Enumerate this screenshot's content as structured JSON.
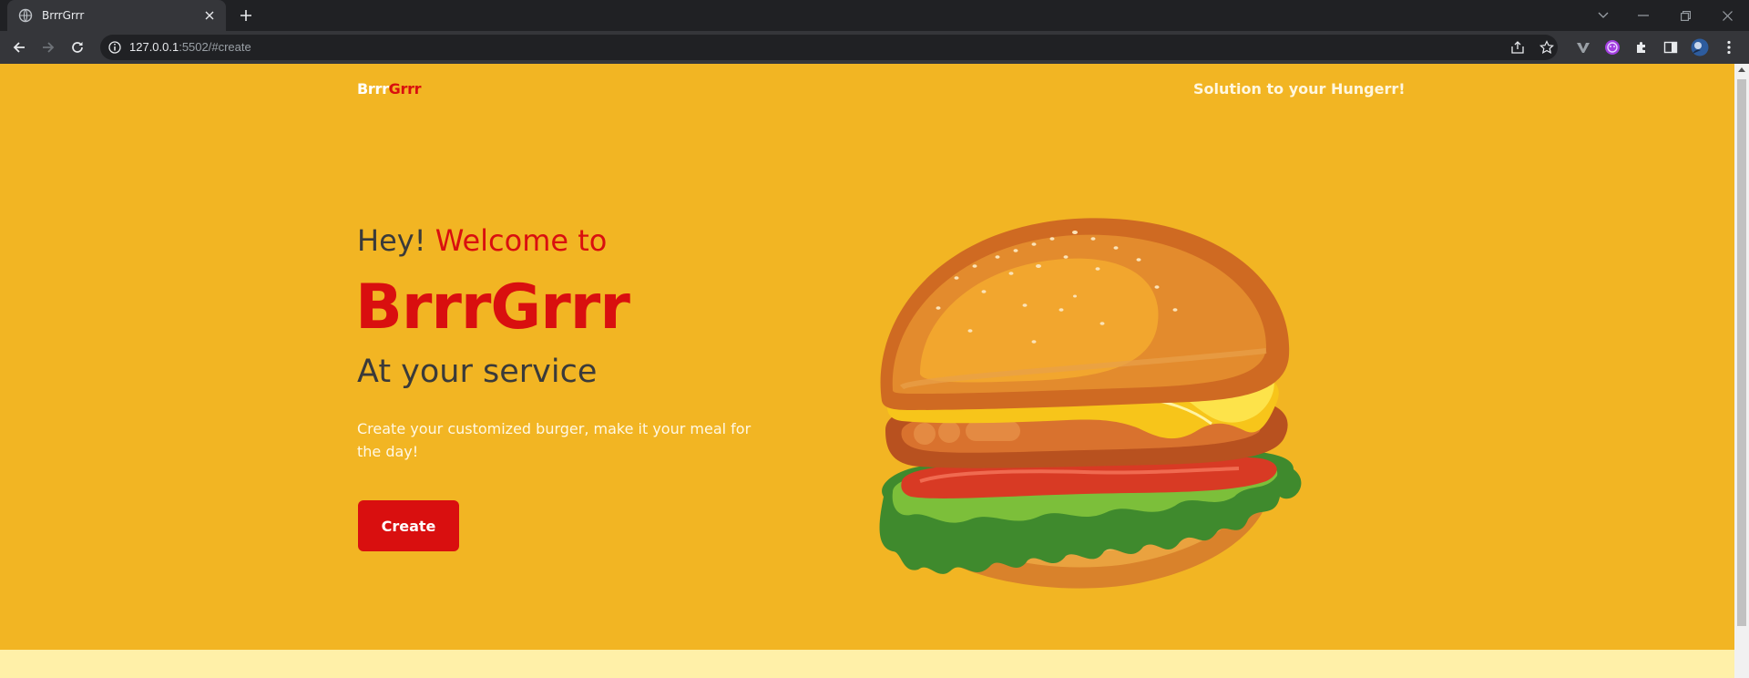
{
  "browser": {
    "tab_title": "BrrrGrrr",
    "url_host": "127.0.0.1",
    "url_rest": ":5502/#create"
  },
  "page": {
    "brand_part1": "Brrr",
    "brand_part2": "Grrr",
    "tagline": "Solution to your Hungerr!",
    "hero_greeting": "Hey!",
    "hero_welcome": "Welcome to",
    "hero_title": "BrrrGrrr",
    "hero_subtitle": "At your service",
    "hero_description": "Create your customized burger, make it your meal for the day!",
    "create_button": "Create"
  },
  "colors": {
    "page_bg": "#f2b523",
    "accent_red": "#d90f0f",
    "dark_text": "#3a3a3a",
    "footer_strip": "#fff0a8"
  }
}
